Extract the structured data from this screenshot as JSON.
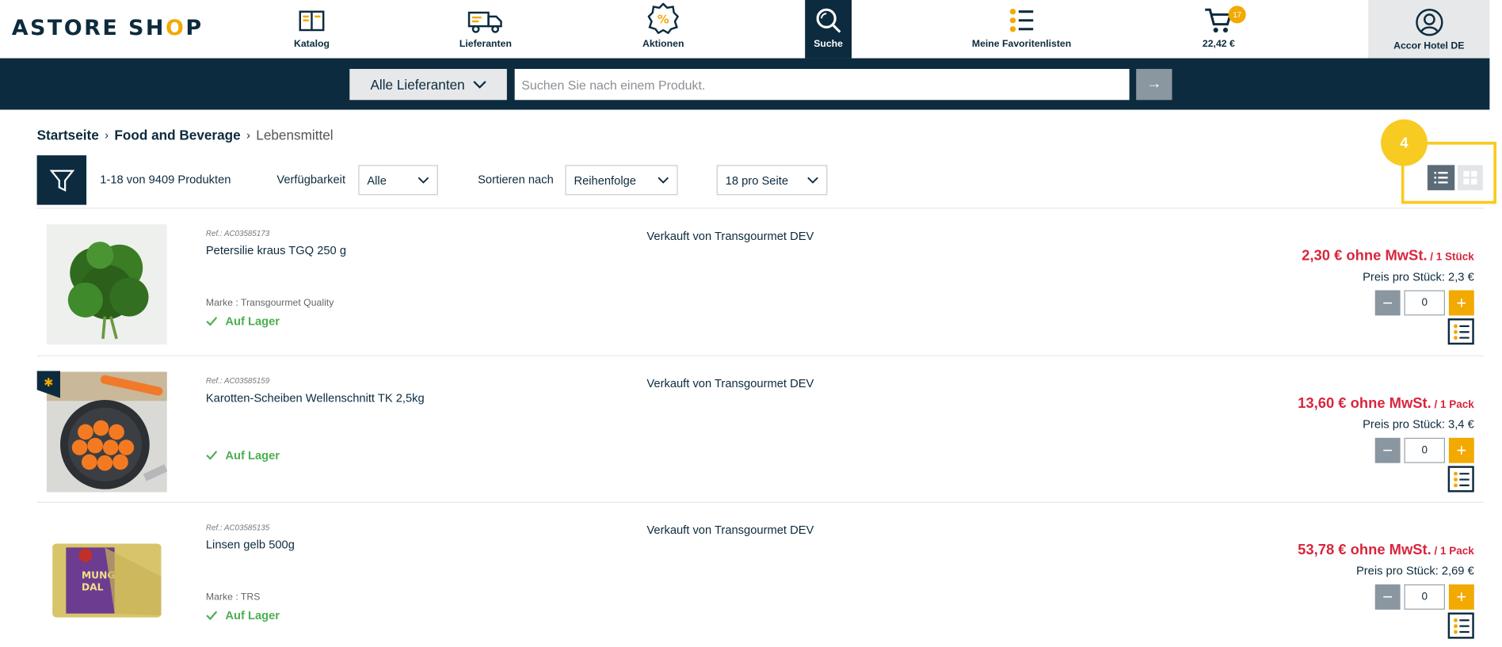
{
  "header": {
    "logo_pre": "ASTORE SH",
    "logo_o": "O",
    "logo_post": "P",
    "nav": [
      {
        "label": "Katalog",
        "icon": "book-icon"
      },
      {
        "label": "Lieferanten",
        "icon": "truck-icon"
      },
      {
        "label": "Aktionen",
        "icon": "percent-badge-icon"
      },
      {
        "label": "Suche",
        "icon": "search-icon"
      },
      {
        "label": "Meine Favoritenlisten",
        "icon": "list-icon"
      }
    ],
    "cart": {
      "total": "22,42 €",
      "count": "17",
      "icon": "cart-icon"
    },
    "account": {
      "label": "Accor Hotel DE",
      "icon": "user-icon"
    }
  },
  "search": {
    "supplier_filter": "Alle Lieferanten",
    "placeholder": "Suchen Sie nach einem Produkt.",
    "submit": "→"
  },
  "breadcrumb": {
    "home": "Startseite",
    "category": "Food and Beverage",
    "current": "Lebensmittel"
  },
  "toolbar": {
    "result_count": "1-18 von 9409 Produkten",
    "availability_label": "Verfügbarkeit",
    "availability_value": "Alle",
    "sort_label": "Sortieren nach",
    "sort_value": "Reihenfolge",
    "per_page_value": "18 pro Seite",
    "annotation_number": "4"
  },
  "products": [
    {
      "ref": "Ref.: AC03585173",
      "name": "Petersilie kraus TGQ 250 g",
      "brand": "Marke : Transgourmet Quality",
      "stock": "Auf Lager",
      "seller": "Verkauft von Transgourmet DEV",
      "price": "2,30 € ohne MwSt.",
      "unit": " / 1 Stück",
      "unit_price": "Preis pro Stück: 2,3 €",
      "qty": "0"
    },
    {
      "ref": "Ref.: AC03585159",
      "name": "Karotten-Scheiben Wellenschnitt TK 2,5kg",
      "brand": "",
      "stock": "Auf Lager",
      "seller": "Verkauft von Transgourmet DEV",
      "price": "13,60 € ohne MwSt.",
      "unit": " / 1 Pack",
      "unit_price": "Preis pro Stück: 3,4 €",
      "qty": "0"
    },
    {
      "ref": "Ref.: AC03585135",
      "name": "Linsen gelb 500g",
      "brand": "Marke : TRS",
      "stock": "Auf Lager",
      "seller": "Verkauft von Transgourmet DEV",
      "price": "53,78 € ohne MwSt.",
      "unit": " / 1 Pack",
      "unit_price": "Preis pro Stück: 2,69 €",
      "qty": "0"
    }
  ],
  "colors": {
    "navy": "#0d2b3e",
    "accent": "#f2a900",
    "price_red": "#d7263d",
    "stock_green": "#4caf50",
    "annotation_yellow": "#f7cb21"
  }
}
